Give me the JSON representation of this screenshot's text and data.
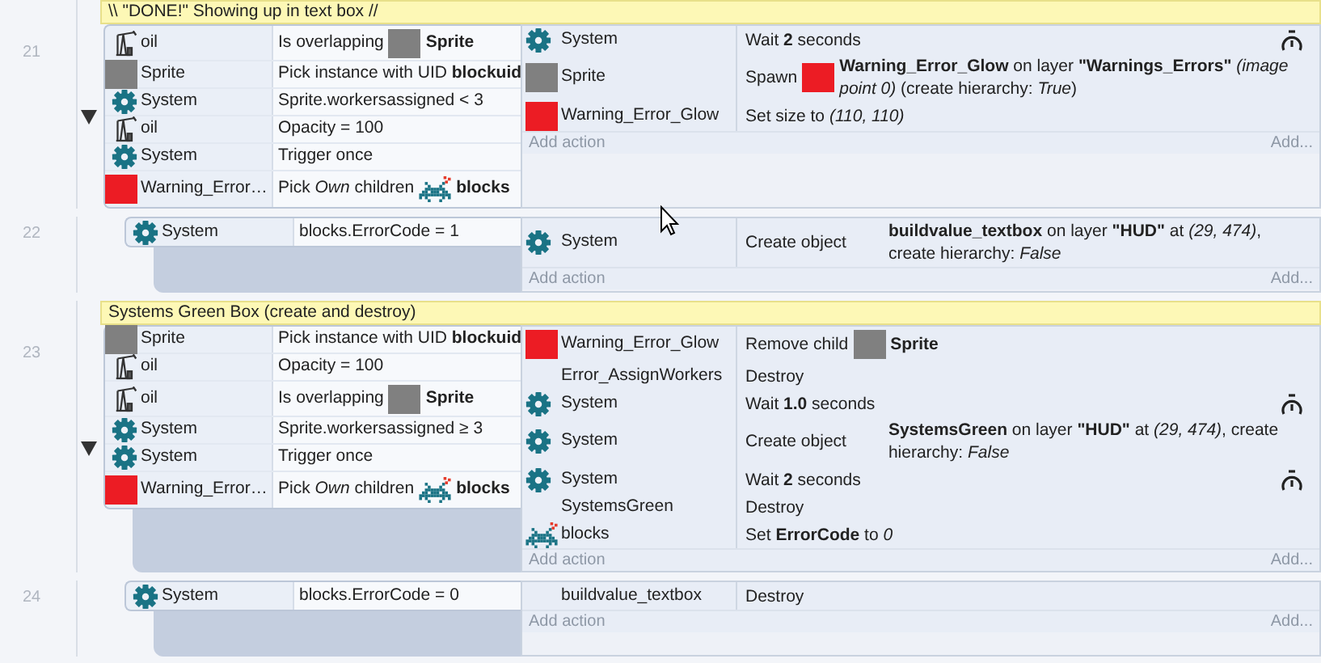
{
  "events": [
    {
      "number": "21",
      "comment": "\\\\ \"DONE!\" Showing up in text box //",
      "expanded": true,
      "conditions": [
        {
          "kind": "oil",
          "object": "oil",
          "text": "Is overlapping",
          "param": {
            "kind": "sprite",
            "text": "**Sprite**"
          }
        },
        {
          "kind": "sprite",
          "object": "Sprite",
          "text": "Pick instance with UID **blockuid**"
        },
        {
          "kind": "system",
          "object": "System",
          "text": "Sprite.workersassigned < 3"
        },
        {
          "kind": "oil",
          "object": "oil",
          "text": "Opacity = 100"
        },
        {
          "kind": "system",
          "object": "System",
          "text": "Trigger once"
        },
        {
          "kind": "glow",
          "object": "Warning_Error…",
          "text": "Pick *Own* children",
          "param": {
            "kind": "blocks",
            "text": "**blocks**"
          }
        }
      ],
      "actions": [
        {
          "kind": "system",
          "object": "System",
          "text": "Wait **2** seconds",
          "timer": true
        },
        {
          "kind": "sprite",
          "object": "Sprite",
          "text": "Spawn",
          "param": {
            "kind": "glow",
            "text": "**Warning_Error_Glow** on layer **\"Warnings_Errors\"** *(image point 0)* (create hierarchy: *True*)"
          }
        },
        {
          "kind": "glow",
          "object": "Warning_Error_Glow",
          "text": "Set size to *(110, 110)*"
        }
      ],
      "add_action": "Add action",
      "add_more": "Add...",
      "children": [
        {
          "number": "22",
          "conditions": [
            {
              "kind": "system",
              "object": "System",
              "text": "blocks.ErrorCode = 1"
            }
          ],
          "actions": [
            {
              "kind": "system",
              "object": "System",
              "text": "Create object",
              "param": {
                "kind": "gap",
                "text": "**buildvalue_textbox** on layer **\"HUD\"** at *(29, 474)*, create hierarchy: *False*"
              }
            }
          ],
          "add_action": "Add action",
          "add_more": "Add..."
        }
      ]
    },
    {
      "number": "23",
      "comment": "Systems Green Box (create and destroy)",
      "expanded": true,
      "conditions": [
        {
          "kind": "sprite",
          "object": "Sprite",
          "text": "Pick instance with UID **blockuid**"
        },
        {
          "kind": "oil",
          "object": "oil",
          "text": "Opacity = 100"
        },
        {
          "kind": "oil",
          "object": "oil",
          "text": "Is overlapping",
          "param": {
            "kind": "sprite",
            "text": "**Sprite**"
          }
        },
        {
          "kind": "system",
          "object": "System",
          "text": "Sprite.workersassigned ≥ 3"
        },
        {
          "kind": "system",
          "object": "System",
          "text": "Trigger once"
        },
        {
          "kind": "glow",
          "object": "Warning_Error…",
          "text": "Pick *Own* children",
          "param": {
            "kind": "blocks",
            "text": "**blocks**"
          }
        }
      ],
      "actions": [
        {
          "kind": "glow",
          "object": "Warning_Error_Glow",
          "text": "Remove child",
          "param": {
            "kind": "sprite",
            "text": "**Sprite**"
          }
        },
        {
          "object": "Error_AssignWorkers",
          "text": "Destroy"
        },
        {
          "kind": "system",
          "object": "System",
          "text": "Wait **1.0** seconds",
          "timer": true
        },
        {
          "kind": "system",
          "object": "System",
          "text": "Create object",
          "param": {
            "kind": "gap",
            "text": "**SystemsGreen** on layer **\"HUD\"** at *(29, 474)*, create hierarchy: *False*"
          }
        },
        {
          "kind": "system",
          "object": "System",
          "text": "Wait **2** seconds",
          "timer": true
        },
        {
          "object": "SystemsGreen",
          "text": "Destroy"
        },
        {
          "kind": "blocks",
          "object": "blocks",
          "text": "Set **ErrorCode** to *0*"
        }
      ],
      "add_action": "Add action",
      "add_more": "Add...",
      "children": [
        {
          "number": "24",
          "conditions": [
            {
              "kind": "system",
              "object": "System",
              "text": "blocks.ErrorCode = 0"
            }
          ],
          "actions": [
            {
              "object": "buildvalue_textbox",
              "text": "Destroy"
            }
          ],
          "add_action": "Add action",
          "add_more": "Add..."
        }
      ]
    }
  ]
}
